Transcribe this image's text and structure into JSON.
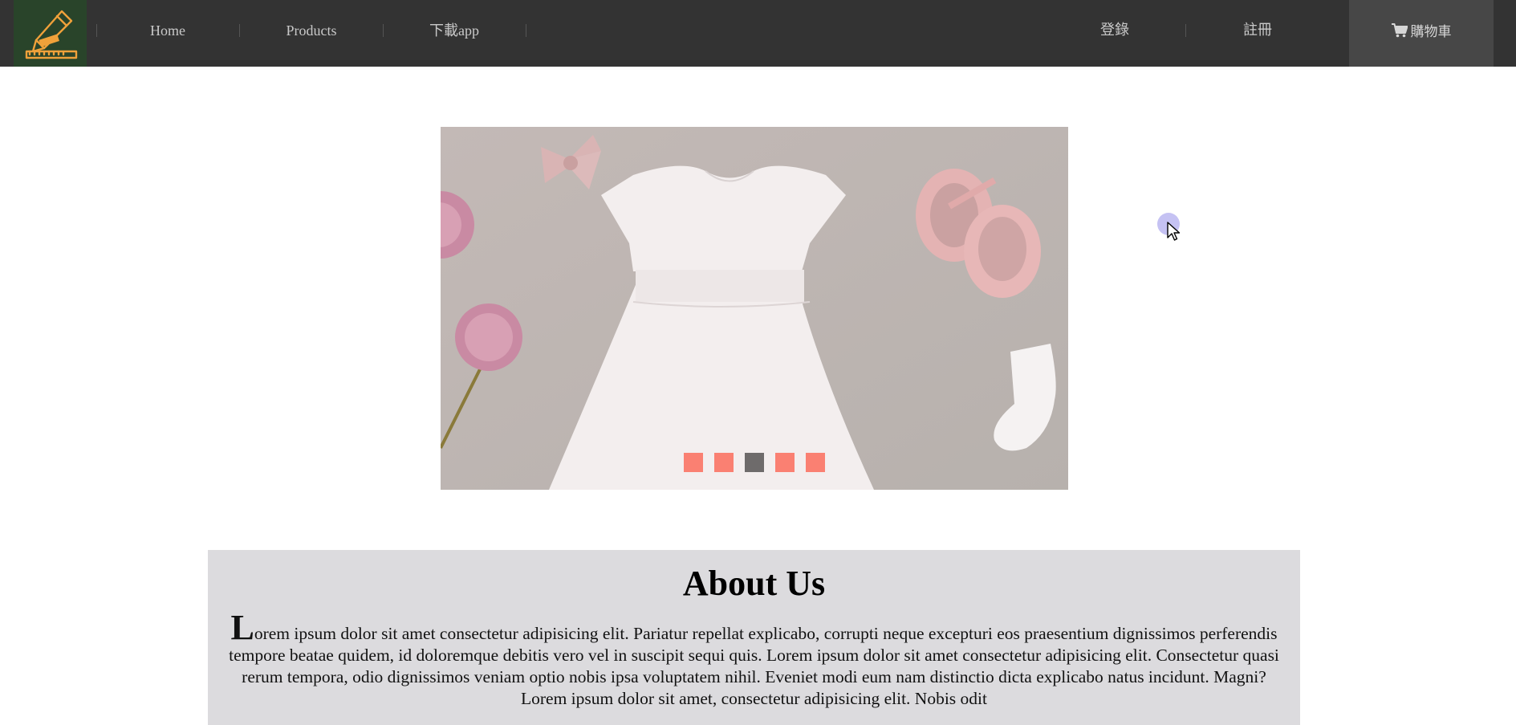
{
  "navbar": {
    "links": [
      {
        "label": "Home"
      },
      {
        "label": "Products"
      },
      {
        "label": "下載app"
      }
    ],
    "login_label": "登錄",
    "register_label": "註冊",
    "cart_label": "購物車",
    "background": "#333333",
    "cart_background": "#474747",
    "logo_background": "#29442a",
    "logo_icon": "pencil-ruler-icon"
  },
  "carousel": {
    "image_alt": "white baby dress with pink shoes, bow, sock and flowers",
    "slide_count": 5,
    "active_index": 2,
    "dot_color": "#fa8072",
    "active_dot_color": "#6e6b6b"
  },
  "about": {
    "title": "About Us",
    "dropcap": "L",
    "body": "orem ipsum dolor sit amet consectetur adipisicing elit. Pariatur repellat explicabo, corrupti neque excepturi eos praesentium dignissimos perferendis tempore beatae quidem, id doloremque debitis vero vel in suscipit sequi quis. Lorem ipsum dolor sit amet consectetur adipisicing elit. Consectetur quasi rerum tempora, odio dignissimos veniam optio nobis ipsa voluptatem nihil. Eveniet modi eum nam distinctio dicta explicabo natus incidunt. Magni? Lorem ipsum dolor sit amet, consectetur adipisicing elit. Nobis odit",
    "background": "#dcdbde"
  }
}
